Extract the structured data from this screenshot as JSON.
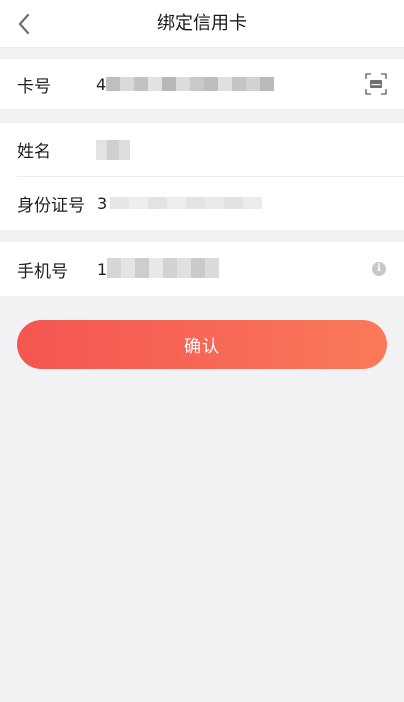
{
  "header": {
    "title": "绑定信用卡",
    "back_icon": "chevron-left-icon"
  },
  "card_number": {
    "label": "卡号",
    "value_visible_prefix": "4",
    "scan_icon": "scan-card-icon"
  },
  "name": {
    "label": "姓名"
  },
  "id_number": {
    "label": "身份证号",
    "value_visible_prefix": "3"
  },
  "phone": {
    "label": "手机号",
    "value_visible_prefix": "1",
    "info_icon": "info-icon",
    "info_glyph": "i"
  },
  "confirm": {
    "label": "确认"
  },
  "colors": {
    "accent_start": "#f45552",
    "accent_end": "#fa7a58",
    "background": "#f2f1f3",
    "card": "#ffffff"
  }
}
